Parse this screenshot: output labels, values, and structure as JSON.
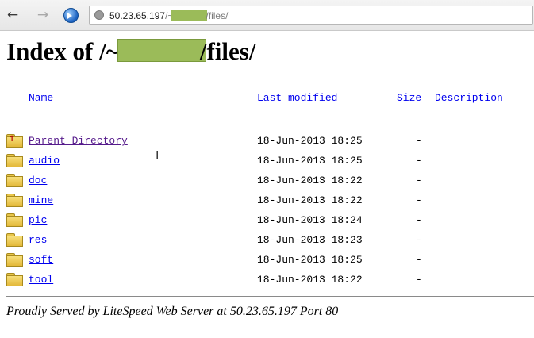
{
  "address_bar": {
    "url_prefix": "50.23.65.197",
    "url_sep": "/~",
    "url_suffix": "/files/"
  },
  "page": {
    "title_prefix": "Index of /~",
    "title_suffix": "/files/"
  },
  "table": {
    "headers": {
      "name": "Name",
      "last_modified": "Last modified",
      "size": "Size",
      "description": "Description"
    },
    "rows": [
      {
        "name": "Parent Directory",
        "modified": "18-Jun-2013 18:25",
        "size": "-",
        "icon": "parent-directory-icon"
      },
      {
        "name": "audio",
        "modified": "18-Jun-2013 18:25",
        "size": "-",
        "icon": "folder-icon"
      },
      {
        "name": "doc",
        "modified": "18-Jun-2013 18:22",
        "size": "-",
        "icon": "folder-icon"
      },
      {
        "name": "mine",
        "modified": "18-Jun-2013 18:22",
        "size": "-",
        "icon": "folder-icon"
      },
      {
        "name": "pic",
        "modified": "18-Jun-2013 18:24",
        "size": "-",
        "icon": "folder-icon"
      },
      {
        "name": "res",
        "modified": "18-Jun-2013 18:23",
        "size": "-",
        "icon": "folder-icon"
      },
      {
        "name": "soft",
        "modified": "18-Jun-2013 18:25",
        "size": "-",
        "icon": "folder-icon"
      },
      {
        "name": "tool",
        "modified": "18-Jun-2013 18:22",
        "size": "-",
        "icon": "folder-icon"
      }
    ]
  },
  "footer": {
    "text": "Proudly Served by LiteSpeed Web Server at 50.23.65.197 Port 80"
  },
  "colors": {
    "link": "#0000ee",
    "visited_link": "#551a8b",
    "redaction": "#9bbb59"
  }
}
